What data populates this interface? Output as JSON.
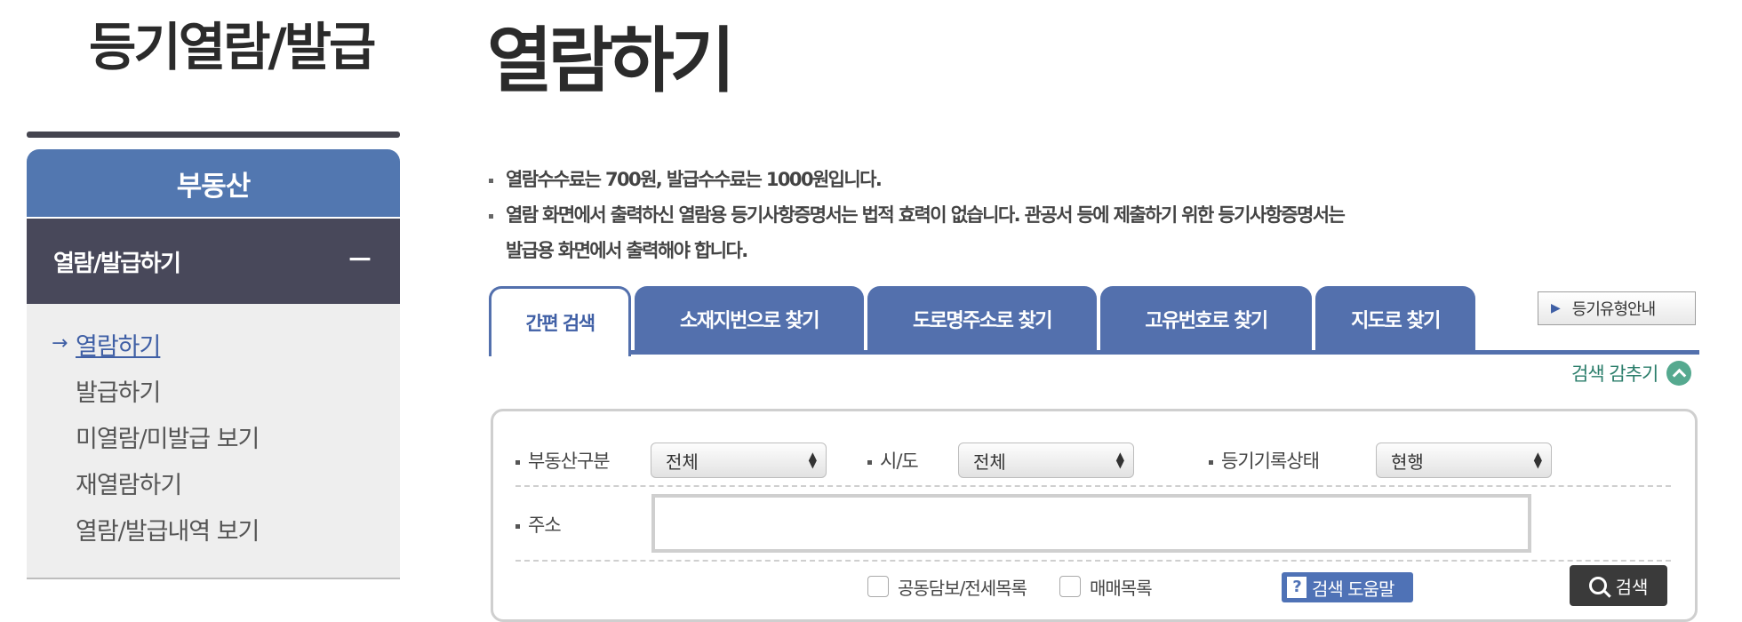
{
  "sidebar": {
    "title": "등기열람/발급",
    "section": "부동산",
    "group_label": "열람/발급하기",
    "group_toggle": "－",
    "items": [
      {
        "label": "열람하기"
      },
      {
        "label": "발급하기"
      },
      {
        "label": "미열람/미발급 보기"
      },
      {
        "label": "재열람하기"
      },
      {
        "label": "열람/발급내역 보기"
      }
    ],
    "active_marker": "→"
  },
  "main": {
    "title": "열람하기",
    "notices": [
      "열람수수료는 700원, 발급수수료는 1000원입니다.",
      "열람 화면에서 출력하신 열람용 등기사항증명서는 법적 효력이 없습니다. 관공서 등에 제출하기 위한 등기사항증명서는",
      "발급용 화면에서 출력해야 합니다."
    ],
    "tabs": [
      {
        "label": "간편 검색"
      },
      {
        "label": "소재지번으로 찾기"
      },
      {
        "label": "도로명주소로 찾기"
      },
      {
        "label": "고유번호로 찾기"
      },
      {
        "label": "지도로 찾기"
      }
    ],
    "guide_button": "등기유형안내",
    "collapse_label": "검색 감추기"
  },
  "search_form": {
    "property_type": {
      "label": "부동산구분",
      "value": "전체"
    },
    "sido": {
      "label": "시/도",
      "value": "전체"
    },
    "record_status": {
      "label": "등기기록상태",
      "value": "현행"
    },
    "address": {
      "label": "주소",
      "value": ""
    },
    "checkbox_joint": {
      "label": "공동담보/전세목록",
      "checked": false
    },
    "checkbox_sale": {
      "label": "매매목록",
      "checked": false
    },
    "help_label": "검색 도움말",
    "help_icon": "?",
    "search_label": "검색"
  },
  "colors": {
    "accent_blue": "#5370ad",
    "sidebar_dark": "#48485a",
    "teal": "#55a98f"
  }
}
